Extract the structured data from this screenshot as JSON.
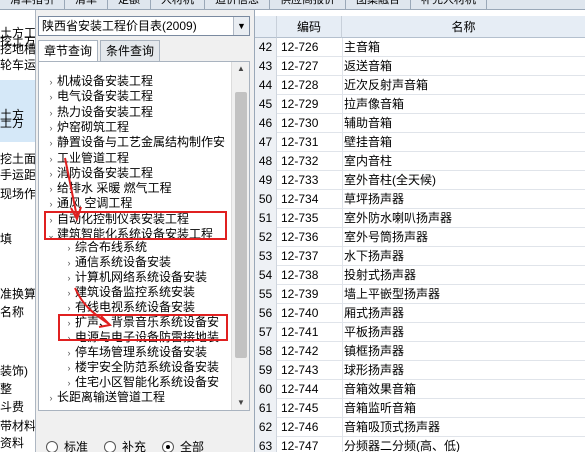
{
  "top_tabs": [
    "清单指引",
    "清单",
    "定额",
    "人材机",
    "造价信息",
    "供应商报价",
    "图集融合",
    "补充人材机"
  ],
  "left_strip": {
    "texts": [
      "土方工",
      "挖地槽",
      "轮车运",
      "土方",
      "挖土方,",
      "土方",
      "挖土面",
      "手运距",
      "现场作",
      "填",
      "准换算",
      "名称",
      "装饰)",
      "整",
      "斗费",
      "带材料",
      "资料"
    ]
  },
  "tree_panel": {
    "combo_value": "陕西省安装工程价目表(2009)",
    "tabs": [
      "章节查询",
      "条件查询"
    ],
    "nodes": [
      {
        "label": "机械设备安装工程",
        "level": 0,
        "expanded": false
      },
      {
        "label": "电气设备安装工程",
        "level": 0,
        "expanded": false
      },
      {
        "label": "热力设备安装工程",
        "level": 0,
        "expanded": false
      },
      {
        "label": "炉窑砌筑工程",
        "level": 0,
        "expanded": false
      },
      {
        "label": "静置设备与工艺金属结构制作安",
        "level": 0,
        "expanded": false
      },
      {
        "label": "工业管道工程",
        "level": 0,
        "expanded": false
      },
      {
        "label": "消防设备安装工程",
        "level": 0,
        "expanded": false
      },
      {
        "label": "给排水 采暖 燃气工程",
        "level": 0,
        "expanded": false
      },
      {
        "label": "通风 空调工程",
        "level": 0,
        "expanded": false
      },
      {
        "label": "自动化控制仪表安装工程",
        "level": 0,
        "expanded": false
      },
      {
        "label": "建筑智能化系统设备安装工程",
        "level": 0,
        "expanded": true
      },
      {
        "label": "综合布线系统",
        "level": 1,
        "expanded": false
      },
      {
        "label": "通信系统设备安装",
        "level": 1,
        "expanded": false
      },
      {
        "label": "计算机网络系统设备安装",
        "level": 1,
        "expanded": false
      },
      {
        "label": "建筑设备监控系统安装",
        "level": 1,
        "expanded": false
      },
      {
        "label": "有线电视系统设备安装",
        "level": 1,
        "expanded": false
      },
      {
        "label": "扩声、背景音乐系统设备安",
        "level": 1,
        "expanded": false
      },
      {
        "label": "电源与电子设备防雷接地装",
        "level": 1,
        "expanded": false
      },
      {
        "label": "停车场管理系统设备安装",
        "level": 1,
        "expanded": false
      },
      {
        "label": "楼宇安全防范系统设备安装",
        "level": 1,
        "expanded": false
      },
      {
        "label": "住宅小区智能化系统设备安",
        "level": 1,
        "expanded": false
      },
      {
        "label": "长距离输送管道工程",
        "level": 0,
        "expanded": false
      }
    ],
    "radio_options": [
      {
        "label": "标准",
        "checked": false
      },
      {
        "label": "补充",
        "checked": false
      },
      {
        "label": "全部",
        "checked": true
      }
    ]
  },
  "grid": {
    "headers": [
      "",
      "编码",
      "名称"
    ],
    "rows": [
      {
        "n": "42",
        "code": "12-726",
        "name": "主音箱"
      },
      {
        "n": "43",
        "code": "12-727",
        "name": "返送音箱"
      },
      {
        "n": "44",
        "code": "12-728",
        "name": "近次反射声音箱"
      },
      {
        "n": "45",
        "code": "12-729",
        "name": "拉声像音箱"
      },
      {
        "n": "46",
        "code": "12-730",
        "name": "辅助音箱"
      },
      {
        "n": "47",
        "code": "12-731",
        "name": "壁挂音箱"
      },
      {
        "n": "48",
        "code": "12-732",
        "name": "室内音柱"
      },
      {
        "n": "49",
        "code": "12-733",
        "name": "室外音柱(全天候)"
      },
      {
        "n": "50",
        "code": "12-734",
        "name": "草坪扬声器"
      },
      {
        "n": "51",
        "code": "12-735",
        "name": "室外防水喇叭扬声器"
      },
      {
        "n": "52",
        "code": "12-736",
        "name": "室外号筒扬声器"
      },
      {
        "n": "53",
        "code": "12-737",
        "name": "水下扬声器"
      },
      {
        "n": "54",
        "code": "12-738",
        "name": "投射式扬声器"
      },
      {
        "n": "55",
        "code": "12-739",
        "name": "墙上平嵌型扬声器"
      },
      {
        "n": "56",
        "code": "12-740",
        "name": "厢式扬声器"
      },
      {
        "n": "57",
        "code": "12-741",
        "name": "平板扬声器"
      },
      {
        "n": "58",
        "code": "12-742",
        "name": "镇框扬声器"
      },
      {
        "n": "59",
        "code": "12-743",
        "name": "球形扬声器"
      },
      {
        "n": "60",
        "code": "12-744",
        "name": "音箱效果音箱"
      },
      {
        "n": "61",
        "code": "12-745",
        "name": "音箱监听音箱"
      },
      {
        "n": "62",
        "code": "12-746",
        "name": "音箱吸顶式扬声器"
      },
      {
        "n": "63",
        "code": "12-747",
        "name": "分频器二分频(高、低)"
      }
    ]
  },
  "colors": {
    "highlight": "#e02020",
    "header_bg": "#e6edf5",
    "selection": "#d5e8f8"
  }
}
